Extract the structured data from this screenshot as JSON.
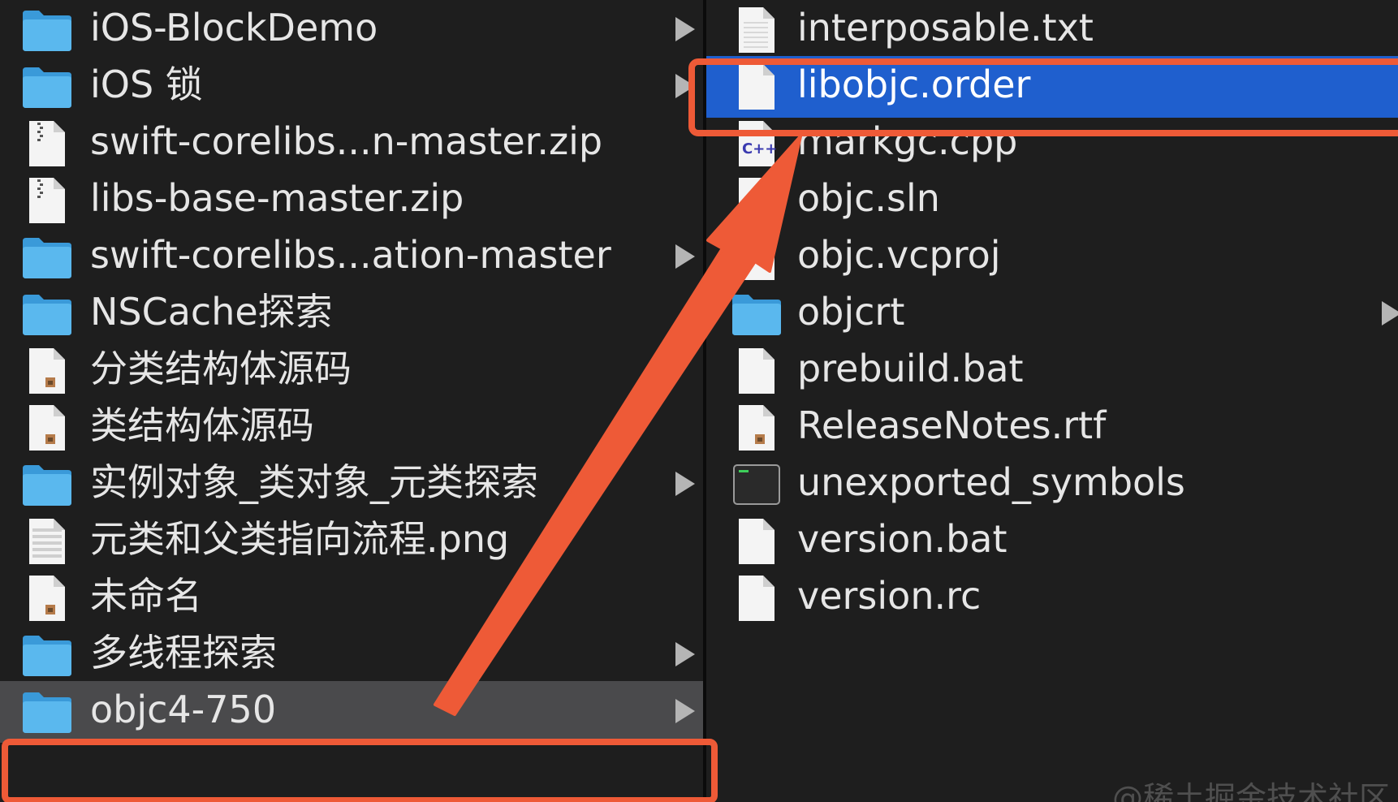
{
  "left_column": {
    "items": [
      {
        "name": "iOS-BlockDemo",
        "kind": "folder",
        "icon": "folder-icon",
        "has_children": true
      },
      {
        "name": "iOS 锁",
        "kind": "folder",
        "icon": "folder-icon",
        "has_children": true
      },
      {
        "name": "swift-corelibs...n-master.zip",
        "kind": "zip",
        "icon": "zip-file-icon",
        "has_children": false
      },
      {
        "name": "libs-base-master.zip",
        "kind": "zip",
        "icon": "zip-file-icon",
        "has_children": false
      },
      {
        "name": "swift-corelibs...ation-master",
        "kind": "folder",
        "icon": "folder-icon",
        "has_children": true
      },
      {
        "name": "NSCache探索",
        "kind": "folder",
        "icon": "folder-icon",
        "has_children": false
      },
      {
        "name": "分类结构体源码",
        "kind": "document",
        "icon": "rich-document-icon",
        "has_children": false
      },
      {
        "name": "类结构体源码",
        "kind": "document",
        "icon": "rich-document-icon",
        "has_children": false
      },
      {
        "name": "实例对象_类对象_元类探索",
        "kind": "folder",
        "icon": "folder-icon",
        "has_children": true
      },
      {
        "name": "元类和父类指向流程.png",
        "kind": "image",
        "icon": "image-file-icon",
        "has_children": false
      },
      {
        "name": "未命名",
        "kind": "document",
        "icon": "rich-document-icon",
        "has_children": false
      },
      {
        "name": "多线程探索",
        "kind": "folder",
        "icon": "folder-icon",
        "has_children": true
      },
      {
        "name": "objc4-750",
        "kind": "folder",
        "icon": "folder-icon",
        "has_children": true,
        "selected": true
      }
    ]
  },
  "right_column": {
    "items": [
      {
        "name": "interposable.txt",
        "kind": "text",
        "icon": "text-file-icon",
        "has_children": false
      },
      {
        "name": "libobjc.order",
        "kind": "file",
        "icon": "blank-file-icon",
        "has_children": false,
        "selected": true
      },
      {
        "name": "markgc.cpp",
        "kind": "cpp",
        "icon": "cpp-file-icon",
        "has_children": false
      },
      {
        "name": "objc.sln",
        "kind": "file",
        "icon": "blank-file-icon",
        "has_children": false
      },
      {
        "name": "objc.vcproj",
        "kind": "file",
        "icon": "blank-file-icon",
        "has_children": false
      },
      {
        "name": "objcrt",
        "kind": "folder",
        "icon": "folder-icon",
        "has_children": true
      },
      {
        "name": "prebuild.bat",
        "kind": "file",
        "icon": "blank-file-icon",
        "has_children": false
      },
      {
        "name": "ReleaseNotes.rtf",
        "kind": "document",
        "icon": "rich-document-icon",
        "has_children": false
      },
      {
        "name": "unexported_symbols",
        "kind": "exec",
        "icon": "terminal-file-icon",
        "has_children": false
      },
      {
        "name": "version.bat",
        "kind": "file",
        "icon": "blank-file-icon",
        "has_children": false
      },
      {
        "name": "version.rc",
        "kind": "file",
        "icon": "blank-file-icon",
        "has_children": false
      }
    ]
  },
  "annotation": {
    "color": "#ee5a37",
    "description": "red arrow from objc4-750 folder to libobjc.order file"
  },
  "watermark": "@稀土掘金技术社区",
  "colors": {
    "background": "#1e1e1e",
    "selection_blue": "#1f5fce",
    "selection_gray": "#4a4a4c",
    "folder_blue": "#5ab8ee"
  }
}
